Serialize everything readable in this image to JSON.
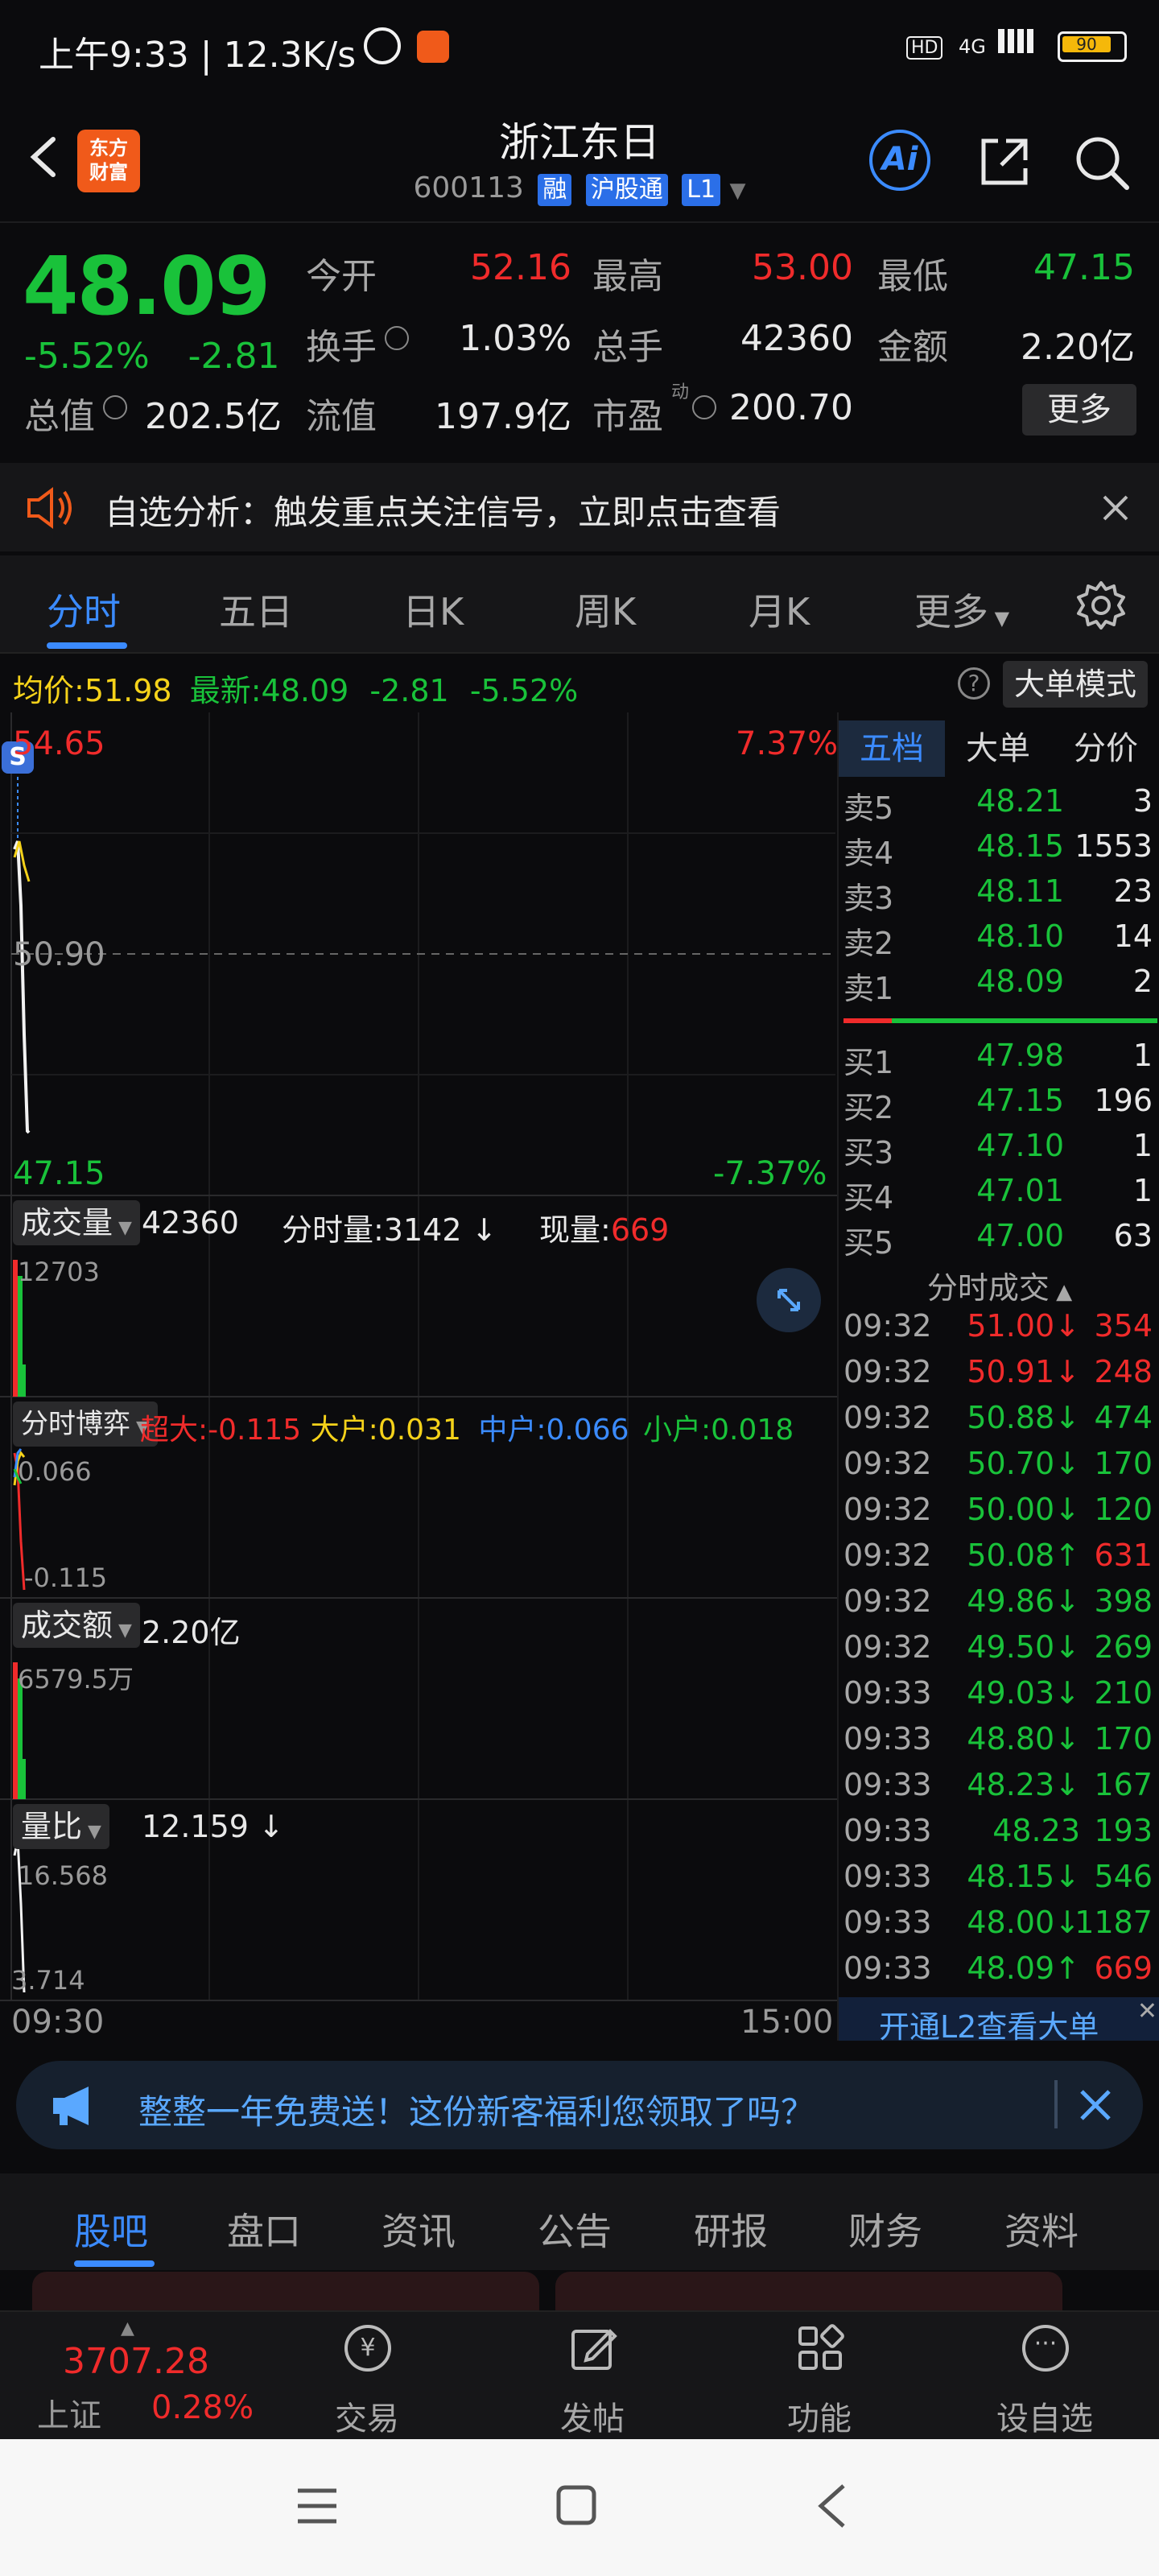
{
  "status_bar": {
    "time": "上午9:33 | 12.3K/s",
    "battery": "90",
    "net": "4G"
  },
  "header": {
    "name": "浙江东日",
    "code": "600113",
    "tags": [
      "融",
      "沪股通",
      "L1"
    ],
    "logo": "东方\n财富",
    "ai": "Ai"
  },
  "quote": {
    "price": "48.09",
    "change_pct": "-5.52%",
    "change": "-2.81",
    "open_label": "今开",
    "open": "52.16",
    "high_label": "最高",
    "high": "53.00",
    "low_label": "最低",
    "low": "47.15",
    "turnover_label": "换手",
    "turnover": "1.03%",
    "vol_label": "总手",
    "vol": "42360",
    "amount_label": "金额",
    "amount": "2.20亿",
    "mcap_label": "总值",
    "mcap": "202.5亿",
    "float_label": "流值",
    "float": "197.9亿",
    "pe_label": "市盈",
    "pe_sup": "动",
    "pe": "200.70",
    "more": "更多"
  },
  "notice": {
    "text": "自选分析：触发重点关注信号，立即点击查看"
  },
  "tabs": [
    "分时",
    "五日",
    "日K",
    "周K",
    "月K",
    "更多"
  ],
  "chart_info": {
    "avg_label": "均价:",
    "avg": "51.98",
    "latest_label": "最新:",
    "latest": "48.09",
    "chg": "-2.81",
    "chg_pct": "-5.52%",
    "big_mode": "大单模式",
    "top_price": "54.65",
    "mid_price": "50.90",
    "bottom_price": "47.15",
    "top_pct": "7.37%",
    "bottom_pct": "-7.37%",
    "vol_label": "成交量",
    "vol": "42360",
    "fs_vol": "分时量:3142 ↓",
    "cur_vol_label": "现量:",
    "cur_vol": "669",
    "vol_max": "12703",
    "game_label": "分时博弈",
    "super_label": "超大:",
    "super": "-0.115",
    "big_label": "大户:",
    "big": "0.031",
    "mid_label": "中户:",
    "mid": "0.066",
    "small_label": "小户:",
    "small": "0.018",
    "game_top": "0.066",
    "game_bottom": "-0.115",
    "amt_label": "成交额",
    "amt": "2.20亿",
    "amt_max": "6579.5万",
    "ratio_label": "量比",
    "ratio": "12.159 ↓",
    "ratio_top": "16.568",
    "ratio_bottom": "3.714",
    "time_start": "09:30",
    "time_end": "15:00"
  },
  "order_book": {
    "tabs": [
      "五档",
      "大单",
      "分价"
    ],
    "sells": [
      {
        "label": "卖5",
        "price": "48.21",
        "qty": "3"
      },
      {
        "label": "卖4",
        "price": "48.15",
        "qty": "1553"
      },
      {
        "label": "卖3",
        "price": "48.11",
        "qty": "23"
      },
      {
        "label": "卖2",
        "price": "48.10",
        "qty": "14"
      },
      {
        "label": "卖1",
        "price": "48.09",
        "qty": "2"
      }
    ],
    "buys": [
      {
        "label": "买1",
        "price": "47.98",
        "qty": "1"
      },
      {
        "label": "买2",
        "price": "47.15",
        "qty": "196"
      },
      {
        "label": "买3",
        "price": "47.10",
        "qty": "1"
      },
      {
        "label": "买4",
        "price": "47.01",
        "qty": "1"
      },
      {
        "label": "买5",
        "price": "47.00",
        "qty": "63"
      }
    ],
    "trades_title": "分时成交",
    "trades": [
      {
        "t": "09:32",
        "p": "51.00↓",
        "q": "354",
        "c": "red"
      },
      {
        "t": "09:32",
        "p": "50.91↓",
        "q": "248",
        "c": "red"
      },
      {
        "t": "09:32",
        "p": "50.88↓",
        "q": "474",
        "c": "green"
      },
      {
        "t": "09:32",
        "p": "50.70↓",
        "q": "170",
        "c": "green"
      },
      {
        "t": "09:32",
        "p": "50.00↓",
        "q": "120",
        "c": "green"
      },
      {
        "t": "09:32",
        "p": "50.08↑",
        "q": "631",
        "c": "green"
      },
      {
        "t": "09:32",
        "p": "49.86↓",
        "q": "398",
        "c": "green"
      },
      {
        "t": "09:32",
        "p": "49.50↓",
        "q": "269",
        "c": "green"
      },
      {
        "t": "09:33",
        "p": "49.03↓",
        "q": "210",
        "c": "green"
      },
      {
        "t": "09:33",
        "p": "48.80↓",
        "q": "170",
        "c": "green"
      },
      {
        "t": "09:33",
        "p": "48.23↓",
        "q": "167",
        "c": "green"
      },
      {
        "t": "09:33",
        "p": "48.23",
        "q": "193",
        "c": "green"
      },
      {
        "t": "09:33",
        "p": "48.15↓",
        "q": "546",
        "c": "green"
      },
      {
        "t": "09:33",
        "p": "48.00↓",
        "q": "1187",
        "c": "green"
      },
      {
        "t": "09:33",
        "p": "48.09↑",
        "q": "669",
        "c": "green"
      }
    ],
    "l2": "开通L2查看大单"
  },
  "promo": {
    "text": "整整一年免费送！这份新客福利您领取了吗？"
  },
  "subtabs": [
    "股吧",
    "盘口",
    "资讯",
    "公告",
    "研报",
    "财务",
    "资料"
  ],
  "bottom_nav": {
    "index_price": "3707.28",
    "index_name": "上证",
    "index_pct": "0.28%",
    "items": [
      "交易",
      "发帖",
      "功能",
      "设自选"
    ]
  }
}
